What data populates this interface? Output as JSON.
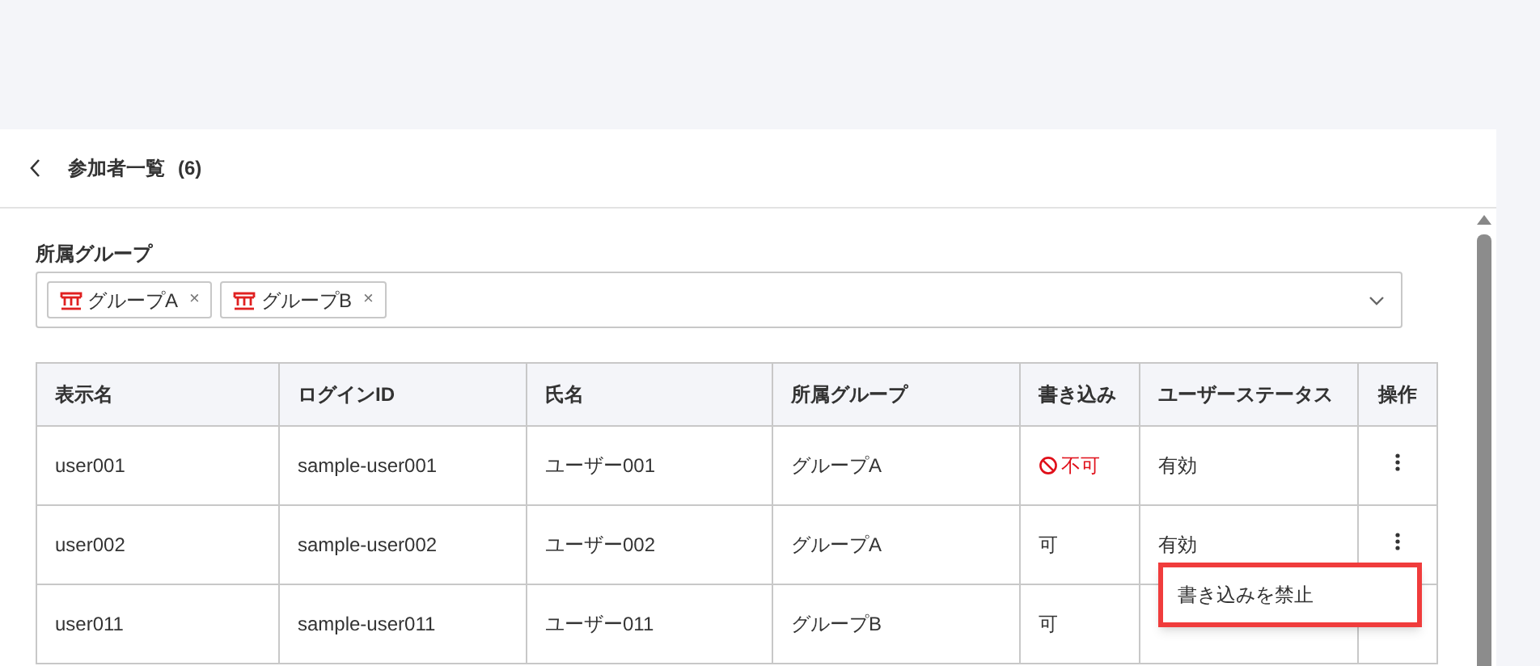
{
  "header": {
    "title": "参加者一覧",
    "count": "(6)"
  },
  "filter": {
    "label": "所属グループ",
    "tags": [
      {
        "label": "グループA",
        "remove": "×"
      },
      {
        "label": "グループB",
        "remove": "×"
      }
    ]
  },
  "table": {
    "columns": [
      "表示名",
      "ログインID",
      "氏名",
      "所属グループ",
      "書き込み",
      "ユーザーステータス",
      "操作"
    ],
    "rows": [
      {
        "display_name": "user001",
        "login_id": "sample-user001",
        "name": "ユーザー001",
        "group": "グループA",
        "write": "不可",
        "write_allowed": false,
        "status": "有効",
        "menu_hidden": false
      },
      {
        "display_name": "user002",
        "login_id": "sample-user002",
        "name": "ユーザー002",
        "group": "グループA",
        "write": "可",
        "write_allowed": true,
        "status": "有効",
        "menu_hidden": false
      },
      {
        "display_name": "user011",
        "login_id": "sample-user011",
        "name": "ユーザー011",
        "group": "グループB",
        "write": "可",
        "write_allowed": true,
        "menu_hidden": true
      }
    ]
  },
  "context_menu": {
    "items": [
      "書き込みを禁止"
    ]
  }
}
